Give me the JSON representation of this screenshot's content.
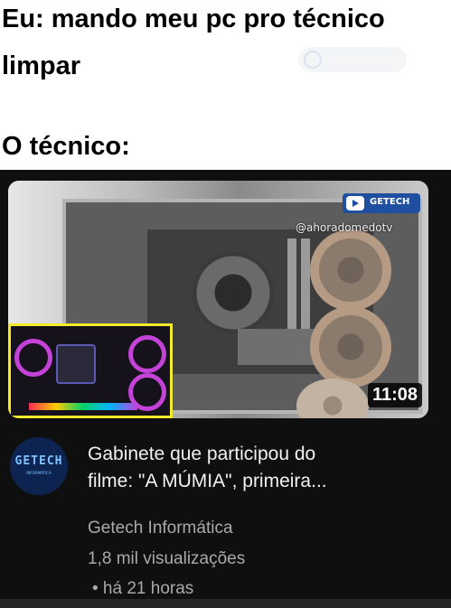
{
  "caption": {
    "line1": "Eu: mando meu pc pro técnico",
    "line2": "limpar",
    "line3": "O técnico:"
  },
  "video": {
    "thumbnail": {
      "watermark_logo_text": "GETECH",
      "watermark_handle": "@ahoradomedotv",
      "duration": "11:08"
    },
    "channel_avatar_text": "GETECH",
    "channel_avatar_sub": "INFORMÁTICA",
    "title_line1": "Gabinete que participou do",
    "title_line2": "filme: \"A MÚMIA\", primeira...",
    "channel_name": "Getech Informática",
    "views": "1,8 mil visualizações",
    "age": "• há 21 horas"
  },
  "colors": {
    "background": "#0f0f0f",
    "caption_bg": "#ffffff",
    "primary_text": "#f1f1f1",
    "secondary_text": "#aaaaaa",
    "inset_border": "#f3ea2b"
  }
}
